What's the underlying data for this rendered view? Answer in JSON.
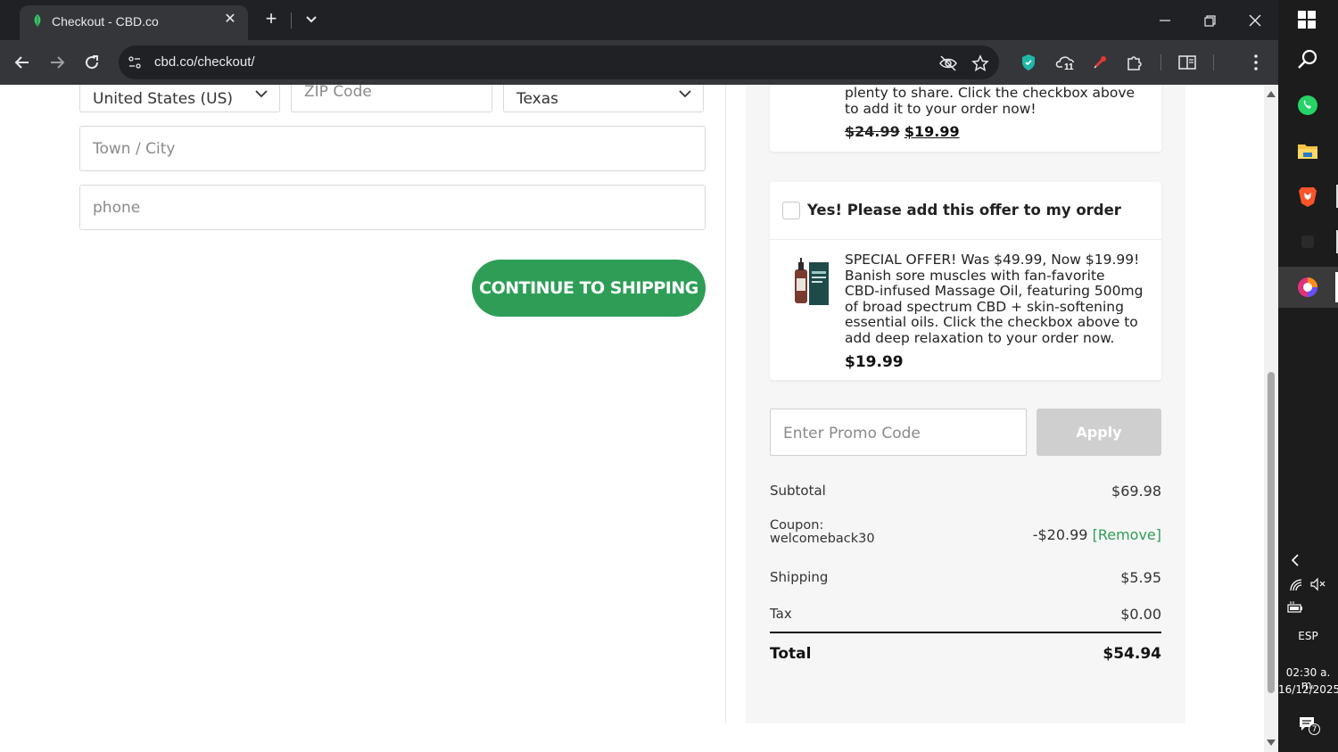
{
  "browser": {
    "tab_title": "Checkout - CBD.co",
    "url": "cbd.co/checkout/",
    "extension_badge": "11"
  },
  "form": {
    "country_value": "United States (US)",
    "zip_placeholder": "ZIP Code",
    "state_value": "Texas",
    "city_placeholder": "Town / City",
    "phone_placeholder": "phone",
    "continue_label": "CONTINUE TO SHIPPING"
  },
  "offer1": {
    "desc_line1": "plenty to share. Click the checkbox above",
    "desc_line2": "to add it to your order now!",
    "old_price": "$24.99",
    "new_price": "$19.99"
  },
  "offer2": {
    "checkbox_label": "Yes! Please add this offer to my order",
    "desc_lines": [
      "SPECIAL OFFER! Was $49.99, Now $19.99!",
      "Banish sore muscles with fan-favorite",
      "CBD-infused Massage Oil, featuring 500mg",
      "of broad spectrum CBD + skin-softening",
      "essential oils. Click the checkbox above to",
      "add deep relaxation to your order now."
    ],
    "price": "$19.99"
  },
  "promo": {
    "placeholder": "Enter Promo Code",
    "apply_label": "Apply"
  },
  "summary": {
    "subtotal_label": "Subtotal",
    "subtotal_value": "$69.98",
    "coupon_label": "Coupon:",
    "coupon_code": "welcomeback30",
    "coupon_value": "-$20.99",
    "remove_label": "[Remove]",
    "shipping_label": "Shipping",
    "shipping_value": "$5.95",
    "tax_label": "Tax",
    "tax_value": "$0.00",
    "total_label": "Total",
    "total_value": "$54.94"
  },
  "taskbar": {
    "language": "ESP",
    "time": "02:30 a. m.",
    "date": "16/12/2025",
    "notification_count": "7"
  },
  "colors": {
    "brand_green": "#2e9e57",
    "apply_disabled": "#cfcfcf"
  }
}
